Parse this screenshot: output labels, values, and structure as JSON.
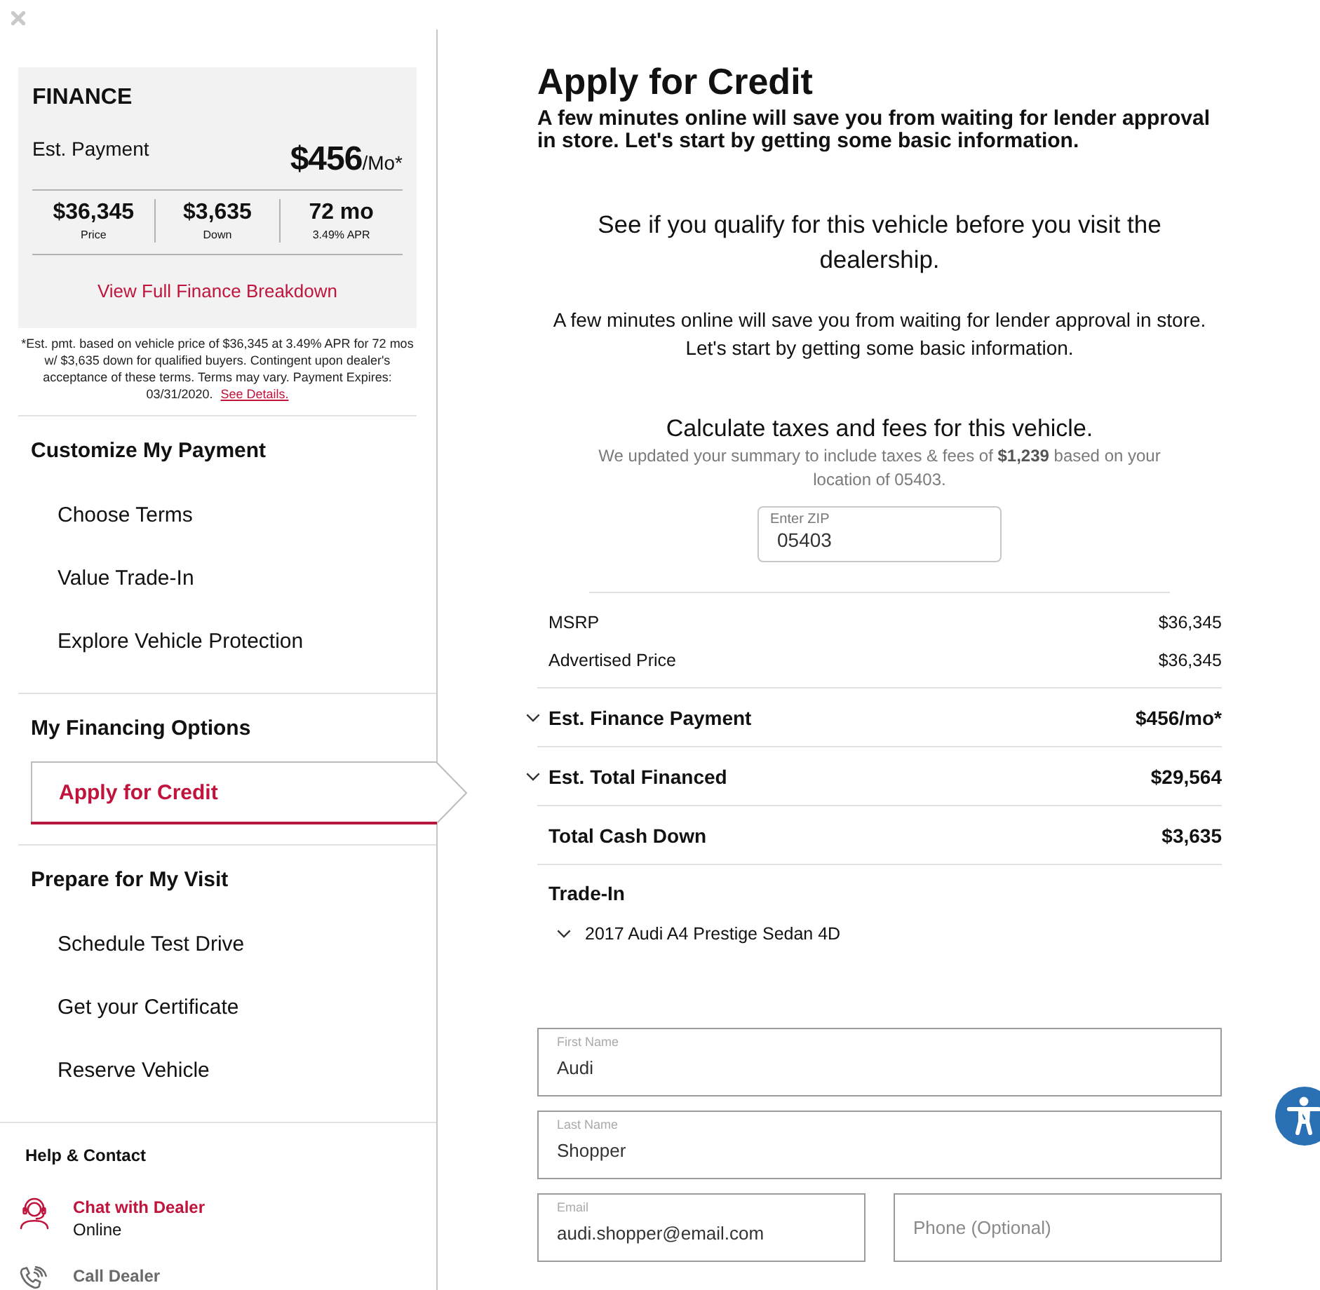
{
  "finance_card": {
    "title": "FINANCE",
    "payment_label": "Est. Payment",
    "payment_amount": "$456",
    "payment_unit": "/Mo*",
    "stats": [
      {
        "value": "$36,345",
        "label": "Price"
      },
      {
        "value": "$3,635",
        "label": "Down"
      },
      {
        "value": "72 mo",
        "label": "3.49% APR"
      }
    ],
    "link": "View Full Finance Breakdown"
  },
  "disclaimer": {
    "text": "*Est. pmt. based on vehicle price of $36,345 at 3.49% APR for 72 mos w/ $3,635 down for qualified buyers. Contingent upon dealer's acceptance of these terms. Terms may vary. Payment Expires: 03/31/2020.",
    "link": "See Details."
  },
  "sidebar": {
    "sections": [
      {
        "title": "Customize My Payment",
        "items": [
          {
            "label": "Choose Terms",
            "selected": false
          },
          {
            "label": "Value Trade-In",
            "selected": false
          },
          {
            "label": "Explore Vehicle Protection",
            "selected": false
          }
        ]
      },
      {
        "title": "My Financing Options",
        "items": [
          {
            "label": "Apply for Credit",
            "selected": true
          }
        ]
      },
      {
        "title": "Prepare for My Visit",
        "items": [
          {
            "label": "Schedule Test Drive",
            "selected": false
          },
          {
            "label": "Get your Certificate",
            "selected": false
          },
          {
            "label": "Reserve Vehicle",
            "selected": false
          }
        ]
      }
    ]
  },
  "help": {
    "title": "Help & Contact",
    "contacts": [
      {
        "kind": "chat",
        "label": "Chat with Dealer",
        "status": "Online",
        "active": true
      },
      {
        "kind": "call",
        "label": "Call Dealer",
        "active": false
      }
    ]
  },
  "main": {
    "title": "Apply for Credit",
    "subtitle": "A few minutes online will save you from waiting for lender approval in store. Let's start by getting some basic information.",
    "intro_heading": "See if you qualify for this vehicle before you visit the dealership.",
    "intro_text": "A few minutes online will save you from waiting for lender approval in store. Let's start by getting some basic information.",
    "taxes": {
      "heading": "Calculate taxes and fees for this vehicle.",
      "note": "We updated your summary to include taxes & fees of **$1,239** based on your location of 05403.",
      "zip": {
        "label": "Enter ZIP",
        "value": "05403"
      }
    },
    "summary": {
      "rows": [
        {
          "kind": "price",
          "label": "MSRP",
          "value": "$36,345",
          "expandable": false
        },
        {
          "kind": "price",
          "label": "Advertised Price",
          "value": "$36,345",
          "expandable": false
        },
        {
          "kind": "total",
          "label": "Est. Finance Payment",
          "value": "$456/mo*",
          "expandable": true
        },
        {
          "kind": "total",
          "label": "Est. Total Financed",
          "value": "$29,564",
          "expandable": true
        },
        {
          "kind": "total",
          "label": "Total Cash Down",
          "value": "$3,635",
          "expandable": false
        }
      ]
    },
    "trade_in": {
      "title": "Trade-In",
      "vehicle": "2017 Audi A4 Prestige Sedan 4D",
      "expandable": true
    },
    "form": {
      "rows": [
        [
          {
            "label": "First Name",
            "value": "Audi"
          }
        ],
        [
          {
            "label": "Last Name",
            "value": "Shopper"
          }
        ],
        [
          {
            "label": "Email",
            "value": "audi.shopper@email.com"
          },
          {
            "placeholder": "Phone (Optional)"
          }
        ]
      ]
    }
  }
}
